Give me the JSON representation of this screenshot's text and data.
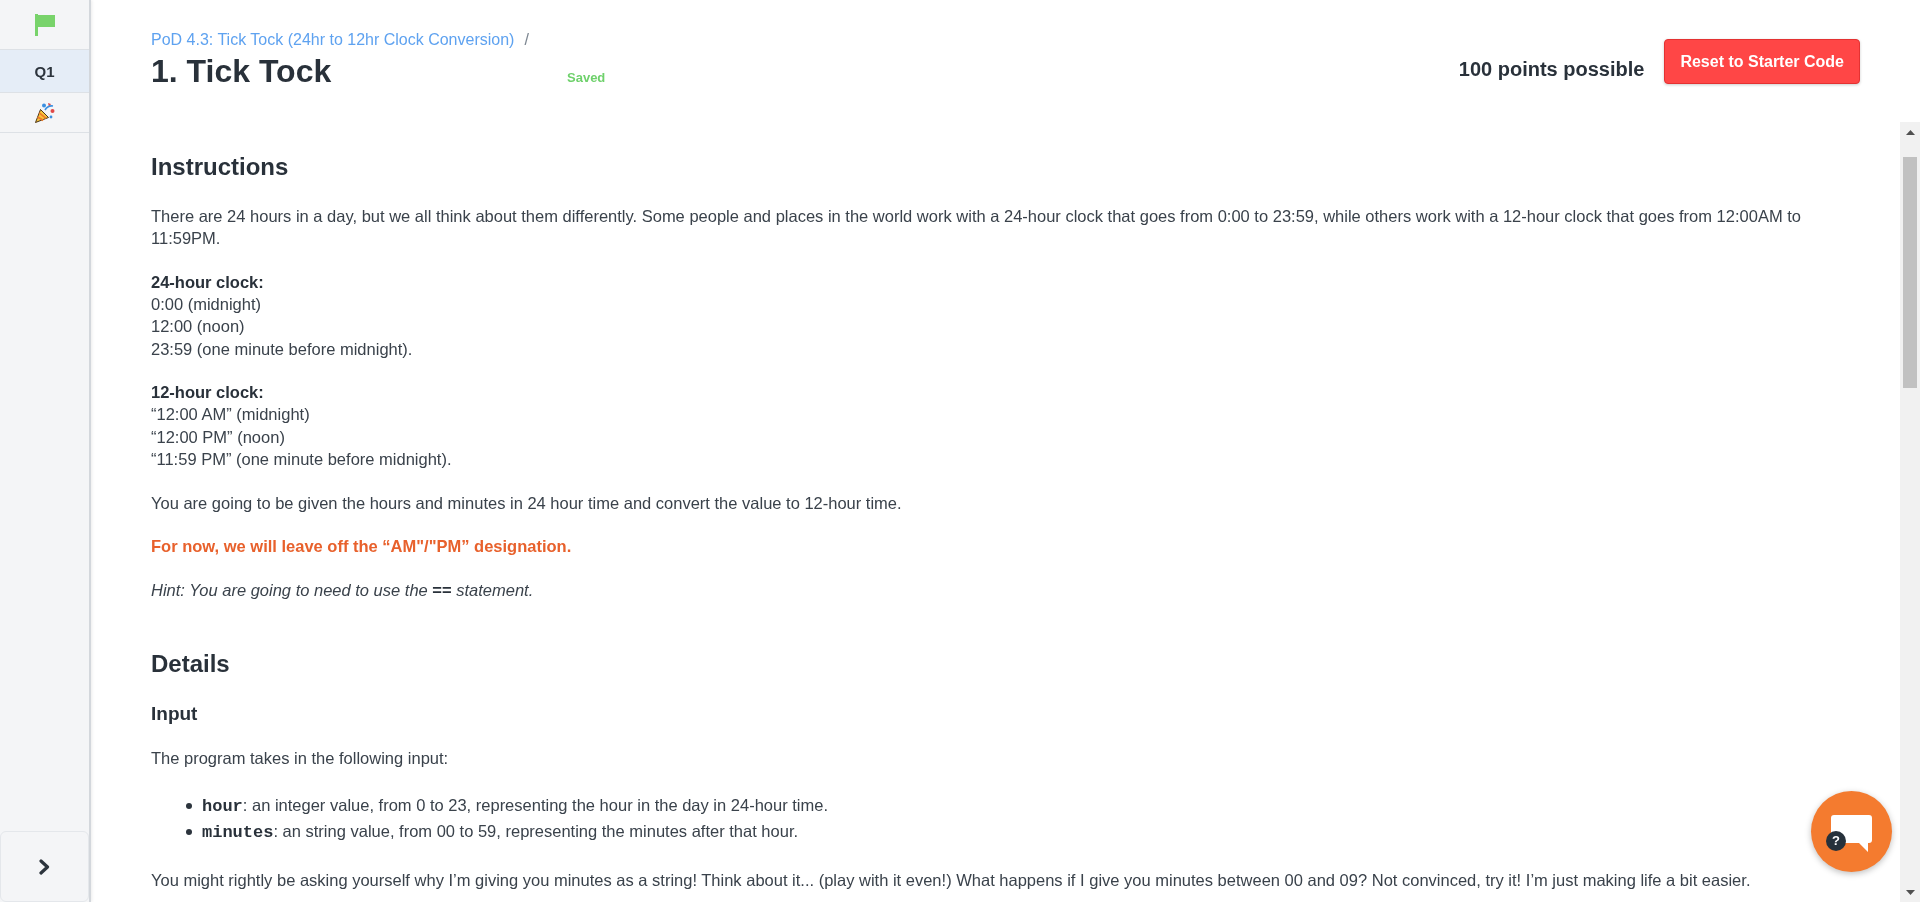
{
  "sidebar": {
    "items": [
      {
        "kind": "flag",
        "selected": false
      },
      {
        "kind": "question",
        "label": "Q1",
        "selected": true
      },
      {
        "kind": "celebration",
        "selected": false
      }
    ]
  },
  "header": {
    "breadcrumb": {
      "link": "PoD 4.3: Tick Tock (24hr to 12hr Clock Conversion)",
      "separator": "/"
    },
    "title": "1. Tick Tock",
    "save_status": "Saved",
    "points": "100 points possible",
    "reset_button": "Reset to Starter Code"
  },
  "sections": [
    {
      "heading": "Instructions",
      "blocks": [
        {
          "kind": "paragraph",
          "text": "There are 24 hours in a day, but we all think about them differently. Some people and places in the world work with a 24-hour clock that goes from 0:00 to 23:59, while others work with a 12-hour clock that goes from 12:00AM to 11:59PM."
        },
        {
          "kind": "clock_list",
          "label": "24-hour clock:",
          "lines": [
            "0:00 (midnight)",
            "12:00 (noon)",
            "23:59 (one minute before midnight)."
          ]
        },
        {
          "kind": "clock_list",
          "label": "12-hour clock:",
          "lines": [
            "“12:00 AM” (midnight)",
            "“12:00 PM” (noon)",
            "“11:59 PM” (one minute before midnight)."
          ]
        },
        {
          "kind": "paragraph",
          "text": "You are going to be given the hours and minutes in 24 hour time and convert the value to 12-hour time."
        },
        {
          "kind": "notice",
          "text": "For now, we will leave off the “AM\"/\"PM” designation."
        },
        {
          "kind": "hint",
          "text": "Hint: You are going to need to use the **==** statement."
        }
      ]
    },
    {
      "heading": "Details",
      "blocks": [
        {
          "kind": "subheading",
          "text": "Input"
        },
        {
          "kind": "paragraph",
          "text": "The program takes in the following input:"
        },
        {
          "kind": "bullets",
          "items": [
            "**hour**: an integer value, from 0 to 23, representing the hour in the day in 24-hour time.",
            "**minutes**: an string value, from 00 to 59, representing the minutes after that hour."
          ]
        },
        {
          "kind": "paragraph",
          "text": "You might rightly be asking yourself why I’m giving you minutes as a string! Think about it... (play with it even!) What happens if I give you minutes between 00 and 09? Not convinced, try it! I’m just making life a bit easier."
        }
      ]
    }
  ],
  "help_widget": {
    "badge": "?"
  }
}
